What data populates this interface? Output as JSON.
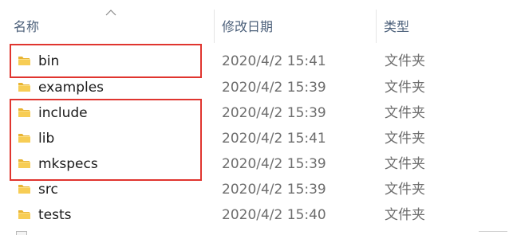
{
  "columns": {
    "name": "名称",
    "date_modified": "修改日期",
    "type": "类型"
  },
  "sort": {
    "column": "name",
    "icon": "sort-up-chevron-icon"
  },
  "colors": {
    "folder": "#f3c346",
    "highlight": "#e0352f",
    "header_text": "#4c607a"
  },
  "files": [
    {
      "name": "bin",
      "date": "2020/4/2 15:41",
      "type": "文件夹",
      "icon": "folder-icon",
      "highlighted": true
    },
    {
      "name": "examples",
      "date": "2020/4/2 15:39",
      "type": "文件夹",
      "icon": "folder-icon",
      "highlighted": false
    },
    {
      "name": "include",
      "date": "2020/4/2 15:39",
      "type": "文件夹",
      "icon": "folder-icon",
      "highlighted": true
    },
    {
      "name": "lib",
      "date": "2020/4/2 15:41",
      "type": "文件夹",
      "icon": "folder-icon",
      "highlighted": true
    },
    {
      "name": "mkspecs",
      "date": "2020/4/2 15:39",
      "type": "文件夹",
      "icon": "folder-icon",
      "highlighted": true
    },
    {
      "name": "src",
      "date": "2020/4/2 15:39",
      "type": "文件夹",
      "icon": "folder-icon",
      "highlighted": false
    },
    {
      "name": "tests",
      "date": "2020/4/2 15:40",
      "type": "文件夹",
      "icon": "folder-icon",
      "highlighted": false
    }
  ]
}
